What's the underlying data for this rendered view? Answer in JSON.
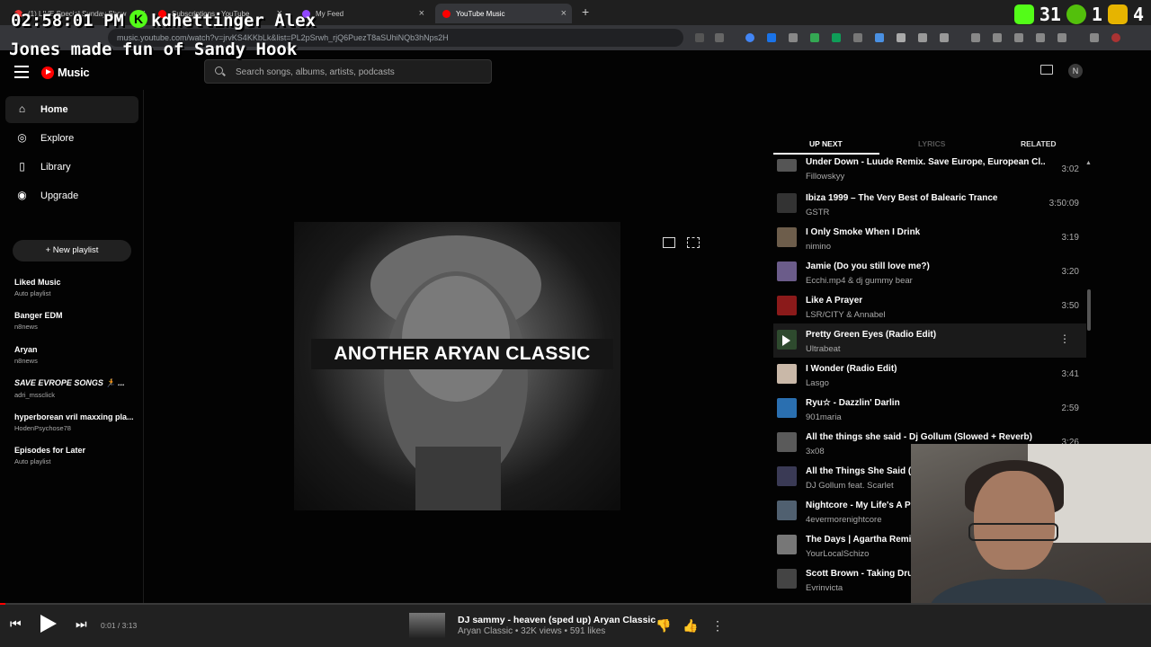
{
  "browser": {
    "tabs": [
      {
        "label": "(1) LIVE Special Sunday Show"
      },
      {
        "label": "Subscriptions - YouTube"
      },
      {
        "label": "My Feed"
      },
      {
        "label": "YouTube Music"
      }
    ],
    "url": "music.youtube.com/watch?v=jrvKS4KKbLk&list=PL2pSrwh_rjQ6PuezT8aSUhiNQb3hNps2H",
    "new_tab": "+"
  },
  "overlay": {
    "time": "02:58:01 PM",
    "k_badge": "K",
    "username": "kdhettinger",
    "name_tail": "Alex",
    "message": "Jones made fun of Sandy Hook",
    "stats": [
      "31",
      "1",
      "4"
    ]
  },
  "header": {
    "logo_text": "Music",
    "search_placeholder": "Search songs, albums, artists, podcasts",
    "avatar_letter": "N"
  },
  "sidebar": {
    "nav": [
      {
        "label": "Home",
        "icon": "home-icon"
      },
      {
        "label": "Explore",
        "icon": "compass-icon"
      },
      {
        "label": "Library",
        "icon": "bookmark-icon"
      },
      {
        "label": "Upgrade",
        "icon": "upgrade-icon"
      }
    ],
    "new_playlist": "New playlist",
    "playlists": [
      {
        "title": "Liked Music",
        "subtitle": "Auto playlist"
      },
      {
        "title": "Banger EDM",
        "subtitle": "n8news"
      },
      {
        "title": "Aryan",
        "subtitle": "n8news"
      },
      {
        "title": "SAVE EVROPE SONGS 🏃 ...",
        "subtitle": "adri_mssclick"
      },
      {
        "title": "hyperborean vril maxxing pla...",
        "subtitle": "HodenPsychose78"
      },
      {
        "title": "Episodes for Later",
        "subtitle": "Auto playlist"
      }
    ]
  },
  "player": {
    "art_caption": "ANOTHER ARYAN CLASSIC"
  },
  "panel": {
    "tabs": [
      "UP NEXT",
      "LYRICS",
      "RELATED"
    ],
    "queue": [
      {
        "title": "Under Down - Luude Remix. Save Europe, European Cl...",
        "artist": "Fillowskyy",
        "duration": "3:02"
      },
      {
        "title": "Ibiza 1999 – The Very Best of Balearic Trance",
        "artist": "GSTR",
        "duration": "3:50:09"
      },
      {
        "title": "I Only Smoke When I Drink",
        "artist": "nimino",
        "duration": "3:19"
      },
      {
        "title": "Jamie (Do you still love me?)",
        "artist": "Ecchi.mp4 & dj gummy bear",
        "duration": "3:20"
      },
      {
        "title": "Like A Prayer",
        "artist": "LSR/CITY & Annabel",
        "duration": "3:50"
      },
      {
        "title": "Pretty Green Eyes (Radio Edit)",
        "artist": "Ultrabeat",
        "duration": ""
      },
      {
        "title": "I Wonder (Radio Edit)",
        "artist": "Lasgo",
        "duration": "3:41"
      },
      {
        "title": "Ryu☆ - Dazzlin' Darlin",
        "artist": "901maria",
        "duration": "2:59"
      },
      {
        "title": "All the things she said - Dj Gollum (Slowed + Reverb)",
        "artist": "3x08",
        "duration": "3:26"
      },
      {
        "title": "All the Things She Said (",
        "artist": "DJ Gollum feat. Scarlet",
        "duration": ""
      },
      {
        "title": "Nightcore - My Life's A P",
        "artist": "4evermorenightcore",
        "duration": ""
      },
      {
        "title": "The Days | Agartha Remi",
        "artist": "YourLocalSchizo",
        "duration": ""
      },
      {
        "title": "Scott Brown - Taking Dru",
        "artist": "Evrinvicta",
        "duration": ""
      }
    ]
  },
  "bottom": {
    "time": "0:01 / 3:13",
    "progress": 0.005,
    "title": "DJ sammy - heaven (sped up) Aryan Classic",
    "subtitle": "Aryan Classic • 32K views • 591 likes"
  },
  "colors": {
    "accent": "#ff0000",
    "bg": "#030303",
    "bar": "#212121"
  }
}
